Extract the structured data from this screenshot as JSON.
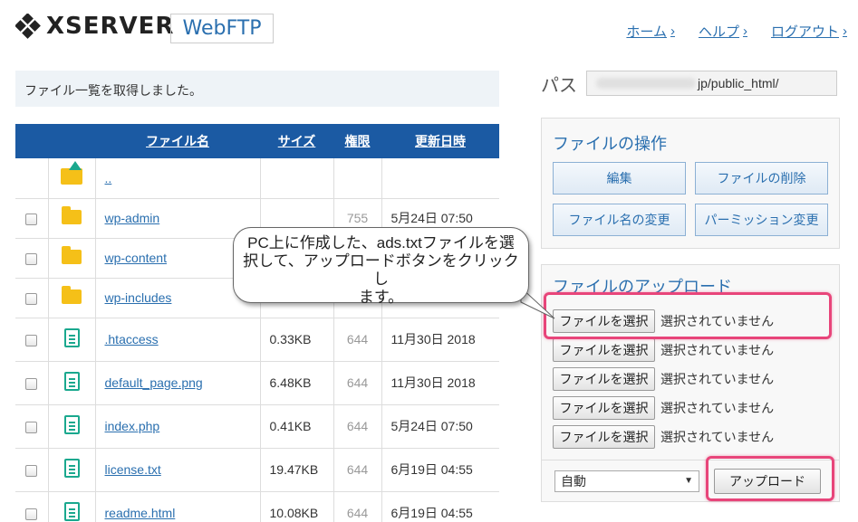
{
  "header": {
    "logo_text": "XSERVER",
    "product": "WebFTP",
    "nav": [
      {
        "label": "ホーム"
      },
      {
        "label": "ヘルプ"
      },
      {
        "label": "ログアウト"
      }
    ]
  },
  "message": "ファイル一覧を取得しました。",
  "table": {
    "headers": {
      "name": "ファイル名",
      "size": "サイズ",
      "perm": "権限",
      "date": "更新日時"
    },
    "parent": {
      "name": ".."
    },
    "rows": [
      {
        "name": "wp-admin",
        "size": "",
        "perm": "755",
        "date": "5月24日 07:50",
        "type": "folder"
      },
      {
        "name": "wp-content",
        "size": "",
        "perm": "",
        "date": "",
        "type": "folder"
      },
      {
        "name": "wp-includes",
        "size": "",
        "perm": "",
        "date": "",
        "type": "folder"
      },
      {
        "name": ".htaccess",
        "size": "0.33KB",
        "perm": "644",
        "date": "11月30日 2018",
        "type": "file"
      },
      {
        "name": "default_page.png",
        "size": "6.48KB",
        "perm": "644",
        "date": "11月30日 2018",
        "type": "file"
      },
      {
        "name": "index.php",
        "size": "0.41KB",
        "perm": "644",
        "date": "5月24日 07:50",
        "type": "file"
      },
      {
        "name": "license.txt",
        "size": "19.47KB",
        "perm": "644",
        "date": "6月19日 04:55",
        "type": "file"
      },
      {
        "name": "readme.html",
        "size": "10.08KB",
        "perm": "644",
        "date": "6月19日 04:55",
        "type": "file"
      }
    ]
  },
  "path": {
    "label": "パス",
    "value": "jp/public_html/"
  },
  "file_ops": {
    "title": "ファイルの操作",
    "buttons": [
      "編集",
      "ファイルの削除",
      "ファイル名の変更",
      "パーミッション変更"
    ]
  },
  "upload": {
    "title": "ファイルのアップロード",
    "choose_label": "ファイルを選択",
    "no_file": "選択されていません",
    "mode": "自動",
    "submit": "アップロード"
  },
  "callout": {
    "lines": [
      "PC上に作成した、ads.txtファイルを選",
      "択して、アップロードボタンをクリックし",
      "ます。"
    ]
  },
  "colors": {
    "header_blue": "#1b5aa3",
    "link_blue": "#2a6faf",
    "highlight": "#e8457a",
    "folder": "#f5c018",
    "file": "#1aa88e"
  }
}
